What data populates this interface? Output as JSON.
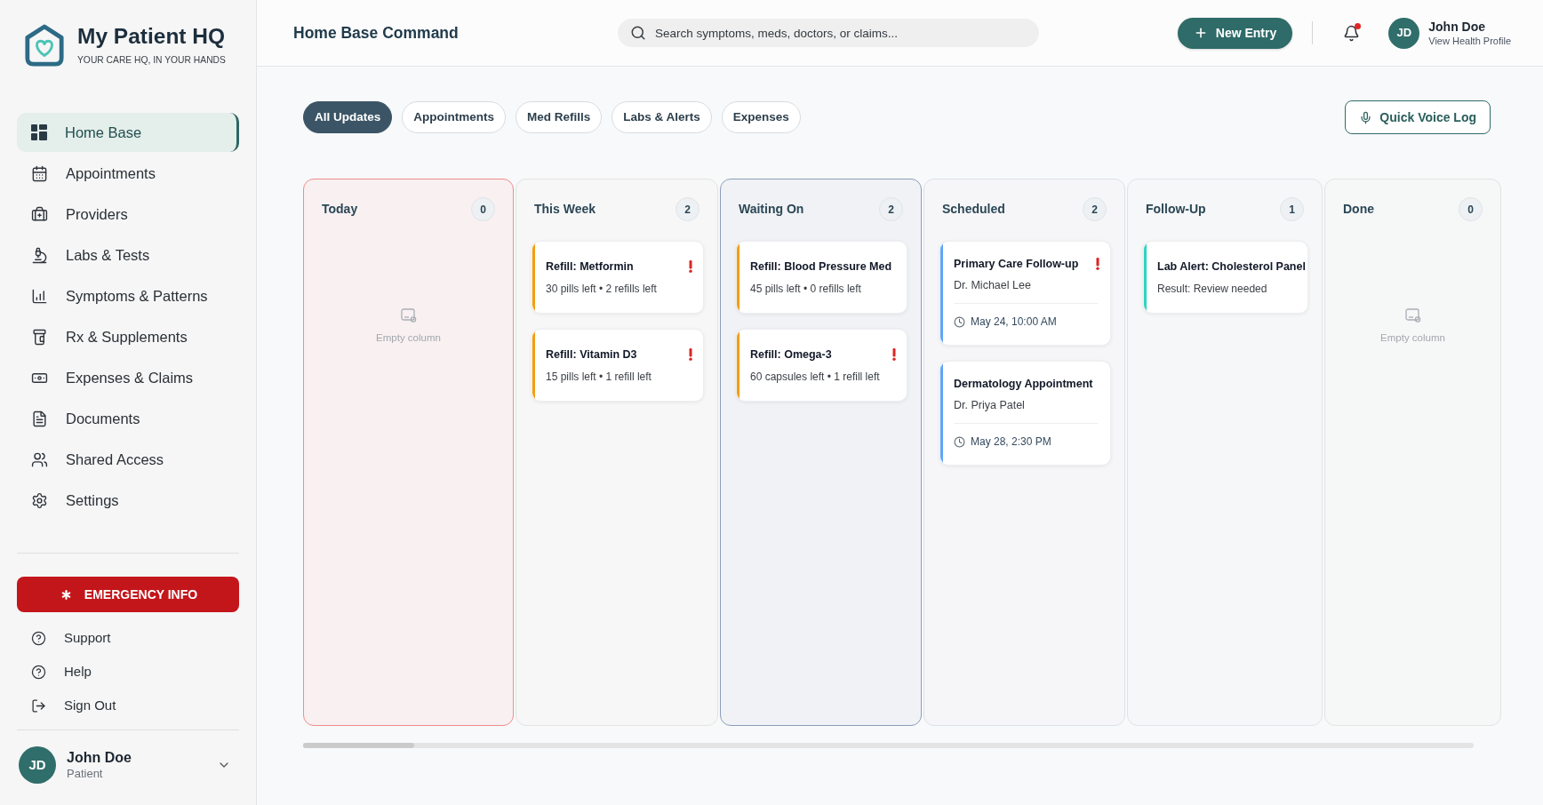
{
  "sidebar": {
    "brand": {
      "title": "My Patient HQ",
      "tagline": "YOUR CARE HQ, IN YOUR HANDS"
    },
    "nav": [
      {
        "label": "Home Base",
        "selected": true
      },
      {
        "label": "Appointments",
        "selected": false
      },
      {
        "label": "Providers",
        "selected": false
      },
      {
        "label": "Labs & Tests",
        "selected": false
      },
      {
        "label": "Symptoms & Patterns",
        "selected": false
      },
      {
        "label": "Rx & Supplements",
        "selected": false
      },
      {
        "label": "Expenses & Claims",
        "selected": false
      },
      {
        "label": "Documents",
        "selected": false
      },
      {
        "label": "Shared Access",
        "selected": false
      },
      {
        "label": "Settings",
        "selected": false
      }
    ],
    "emergency_button": "EMERGENCY INFO",
    "links": [
      "Support",
      "Help",
      "Sign Out"
    ],
    "user": {
      "initials": "JD",
      "name": "John Doe",
      "role": "Patient"
    }
  },
  "header": {
    "title": "Home Base Command",
    "search": {
      "placeholder": "Search symptoms, meds, doctors, or claims..."
    },
    "new_entry_button": "New Entry",
    "notifications": {
      "unread": true
    },
    "user": {
      "initials": "JD",
      "name": "John Doe",
      "link": "View Health Profile"
    }
  },
  "filters": [
    {
      "label": "All Updates",
      "selected": true
    },
    {
      "label": "Appointments",
      "selected": false
    },
    {
      "label": "Med Refills",
      "selected": false
    },
    {
      "label": "Labs & Alerts",
      "selected": false
    },
    {
      "label": "Expenses",
      "selected": false
    }
  ],
  "voice_log_button": "Quick Voice Log",
  "board": {
    "columns": [
      {
        "title": "Today",
        "count": "0",
        "color": "#f28b8b",
        "empty_text": "Empty column"
      },
      {
        "title": "This Week",
        "count": "2",
        "color": "#e3e3e0",
        "cards": [
          {
            "kind": "refill",
            "title": "Refill: Metformin",
            "detail": "30 pills left • 2 refills left",
            "color": "#f59e0b",
            "flagged": true
          },
          {
            "kind": "refill",
            "title": "Refill: Vitamin D3",
            "detail": "15 pills left • 1 refill left",
            "color": "#f59e0b",
            "flagged": true
          }
        ]
      },
      {
        "title": "Waiting On",
        "count": "2",
        "color": "#8c9dbb",
        "cards": [
          {
            "kind": "refill",
            "title": "Refill: Blood Pressure Med",
            "detail": "45 pills left • 0 refills left",
            "color": "#f59e0b",
            "flagged": false
          },
          {
            "kind": "refill",
            "title": "Refill: Omega-3",
            "detail": "60 capsules left • 1 refill left",
            "color": "#f59e0b",
            "flagged": true
          }
        ]
      },
      {
        "title": "Scheduled",
        "count": "2",
        "color": "#dce1e7",
        "cards": [
          {
            "kind": "appointment",
            "title": "Primary Care Follow-up",
            "provider": "Dr. Michael Lee",
            "time": "May 24, 10:00 AM",
            "color": "#60a5fa",
            "flagged": true
          },
          {
            "kind": "appointment",
            "title": "Dermatology Appointment",
            "provider": "Dr. Priya Patel",
            "time": "May 28, 2:30 PM",
            "color": "#60a5fa",
            "flagged": false
          }
        ]
      },
      {
        "title": "Follow-Up",
        "count": "1",
        "color": "#e0e4e8",
        "cards": [
          {
            "kind": "lab",
            "title": "Lab Alert: Cholesterol Panel",
            "detail": "Result: Review needed",
            "color": "#2dd4bf",
            "flagged": false
          }
        ]
      },
      {
        "title": "Done",
        "count": "0",
        "color": "#dfe4e2",
        "empty_text": "Empty column"
      }
    ]
  }
}
